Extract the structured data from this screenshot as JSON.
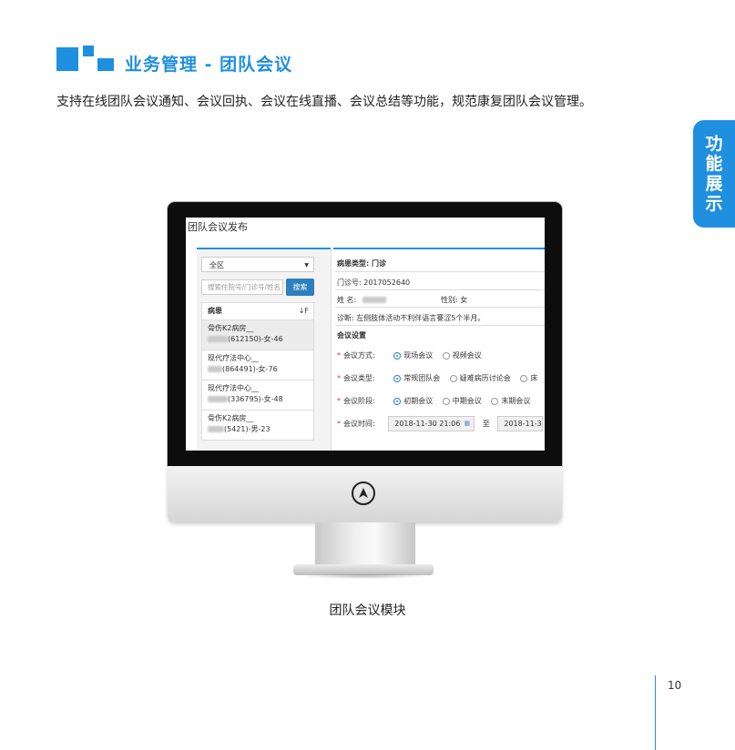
{
  "header": {
    "title": "业务管理 - 团队会议",
    "description": "支持在线团队会议通知、会议回执、会议在线直播、会议总结等功能，规范康复团队会议管理。"
  },
  "side_tab": {
    "chars": [
      "功",
      "能",
      "展",
      "示"
    ]
  },
  "screen": {
    "window_title": "团队会议发布",
    "left_panel": {
      "region_select": "全区",
      "search_placeholder": "搜索住院号/门诊号/姓名",
      "search_button": "搜索",
      "list_header": "病患",
      "sort_icon": "sort-icon",
      "patients": [
        {
          "line1": "骨伤K2病房__",
          "line2": "(612150)-女-46"
        },
        {
          "line1": "现代疗法中心__",
          "line2": "(864491)-女-76"
        },
        {
          "line1": "现代疗法中心__",
          "line2": "(336795)-女-48"
        },
        {
          "line1": "骨伤K2病房__",
          "line2": "(5421)-男-23"
        }
      ]
    },
    "right_panel": {
      "patient_type_label": "病患类型:",
      "patient_type_value": "门诊",
      "outpatient_no": "门诊号: 2017052640",
      "name_label": "姓  名:",
      "gender": "性别: 女",
      "diagnosis": "诊断: 左侧肢体活动不利伴语言謇涩5个半月。",
      "section_title": "会议设置",
      "meeting_mode": {
        "label": "会议方式:",
        "options": [
          "现场会议",
          "视频会议"
        ],
        "selected": 0
      },
      "meeting_type": {
        "label": "会议类型:",
        "options": [
          "常规团队会",
          "疑难病历讨论会",
          "床"
        ],
        "selected": 0
      },
      "meeting_stage": {
        "label": "会议阶段:",
        "options": [
          "初期会议",
          "中期会议",
          "末期会议"
        ],
        "selected": 0
      },
      "meeting_time": {
        "label": "会议时间:",
        "start": "2018-11-30 21:06",
        "to": "至",
        "end": "2018-11-3"
      }
    }
  },
  "caption": "团队会议模块",
  "page_number": "10",
  "colors": {
    "accent": "#1f8fe0",
    "button": "#2d7fbf"
  }
}
